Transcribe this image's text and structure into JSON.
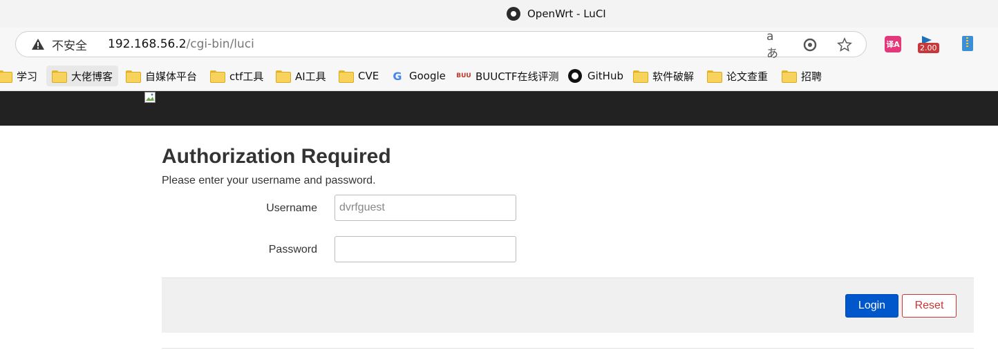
{
  "browser": {
    "tab_title": "OpenWrt - LuCI",
    "security_label": "不安全",
    "url_host": "192.168.56.2",
    "url_path": "/cgi-bin/luci",
    "read_aloud_label": "aあ",
    "ext_speed_badge": "2.00",
    "ext_translate_label": "译A"
  },
  "bookmarks": [
    {
      "label": "学习",
      "icon": "folder-icon"
    },
    {
      "label": "大佬博客",
      "icon": "folder-icon"
    },
    {
      "label": "自媒体平台",
      "icon": "folder-icon"
    },
    {
      "label": "ctf工具",
      "icon": "folder-icon"
    },
    {
      "label": "AI工具",
      "icon": "folder-icon"
    },
    {
      "label": "CVE",
      "icon": "folder-icon"
    },
    {
      "label": "Google",
      "icon": "google-icon"
    },
    {
      "label": "BUUCTF在线评测",
      "icon": "buuctf-icon"
    },
    {
      "label": "GitHub",
      "icon": "github-icon"
    },
    {
      "label": "软件破解",
      "icon": "folder-icon"
    },
    {
      "label": "论文查重",
      "icon": "folder-icon"
    },
    {
      "label": "招聘",
      "icon": "folder-icon"
    }
  ],
  "login": {
    "title": "Authorization Required",
    "description": "Please enter your username and password.",
    "username_label": "Username",
    "username_value": "dvrfguest",
    "password_label": "Password",
    "password_value": "",
    "login_button": "Login",
    "reset_button": "Reset"
  },
  "colors": {
    "header_bg": "#222222",
    "login_button": "#0057cc",
    "reset_button_border": "#cc3333"
  }
}
